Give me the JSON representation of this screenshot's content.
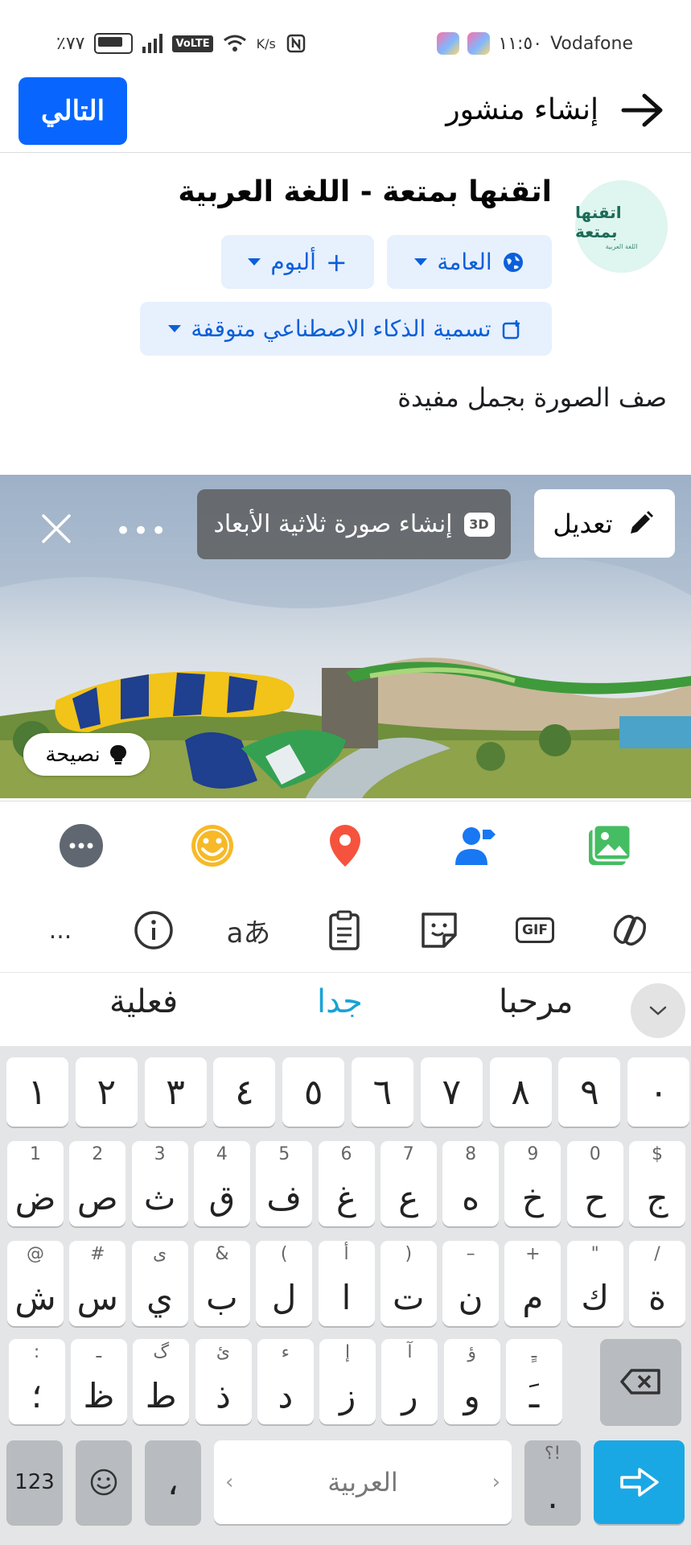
{
  "status_bar": {
    "carrier": "Vodafone",
    "time": "١١:٥٠",
    "speed": "K/s",
    "volte": "VoLTE",
    "battery": "٪٧٧"
  },
  "header": {
    "title": "إنشاء منشور",
    "next_label": "التالي"
  },
  "profile": {
    "avatar_text": "اتقنها بمتعة",
    "avatar_subtext": "اللغة العربية",
    "page_name": "اتقنها بمتعة - اللغة  العربية",
    "audience_label": "العامة",
    "album_label": "ألبوم",
    "ai_label": "تسمية الذكاء الاصطناعي متوقفة"
  },
  "composer": {
    "caption": "صف الصورة بجمل مفيدة"
  },
  "photo": {
    "edit_label": "تعديل",
    "threed_label": "إنشاء صورة ثلاثية الأبعاد",
    "threed_badge": "3D",
    "more": "•••",
    "tip_label": "نصيحة"
  },
  "toolbar": {
    "items": [
      "photo-icon",
      "tag-people-icon",
      "location-icon",
      "feeling-icon",
      "more-icon"
    ]
  },
  "keyboard_tools": {
    "gif": "GIF",
    "translate": "aあ",
    "more": "..."
  },
  "suggestions": [
    "مرحبا",
    "جدا",
    "فعلية"
  ],
  "keyboard": {
    "numbers": [
      "٠",
      "٩",
      "٨",
      "٧",
      "٦",
      "٥",
      "٤",
      "٣",
      "٢",
      "١"
    ],
    "row1": [
      {
        "hint": "$",
        "main": "ج"
      },
      {
        "hint": "0",
        "main": "ح"
      },
      {
        "hint": "9",
        "main": "خ"
      },
      {
        "hint": "8",
        "main": "ه"
      },
      {
        "hint": "7",
        "main": "ع"
      },
      {
        "hint": "6",
        "main": "غ"
      },
      {
        "hint": "5",
        "main": "ف"
      },
      {
        "hint": "4",
        "main": "ق"
      },
      {
        "hint": "3",
        "main": "ث"
      },
      {
        "hint": "2",
        "main": "ص"
      },
      {
        "hint": "1",
        "main": "ض"
      }
    ],
    "row2": [
      {
        "hint": "/",
        "main": "ة"
      },
      {
        "hint": "\"",
        "main": "ك"
      },
      {
        "hint": "+",
        "main": "م"
      },
      {
        "hint": "–",
        "main": "ن"
      },
      {
        "hint": ")",
        "main": "ت"
      },
      {
        "hint": "أ",
        "main": "ا"
      },
      {
        "hint": "(",
        "main": "ل"
      },
      {
        "hint": "&",
        "main": "ب"
      },
      {
        "hint": "ى",
        "main": "ي"
      },
      {
        "hint": "#",
        "main": "س"
      },
      {
        "hint": "@",
        "main": "ش"
      }
    ],
    "row3": [
      {
        "hint": "ـٍ",
        "main": "ـَ"
      },
      {
        "hint": "ؤ",
        "main": "و"
      },
      {
        "hint": "آ",
        "main": "ر"
      },
      {
        "hint": "إ",
        "main": "ز"
      },
      {
        "hint": "ء",
        "main": "د"
      },
      {
        "hint": "ئ",
        "main": "ذ"
      },
      {
        "hint": "گ",
        "main": "ط"
      },
      {
        "hint": "ـ",
        "main": "ظ"
      },
      {
        "hint": ":",
        "main": "؛"
      }
    ],
    "key_123": "123",
    "comma": "،",
    "space_label": "العربية",
    "period_hint": "؟!",
    "period": "."
  }
}
